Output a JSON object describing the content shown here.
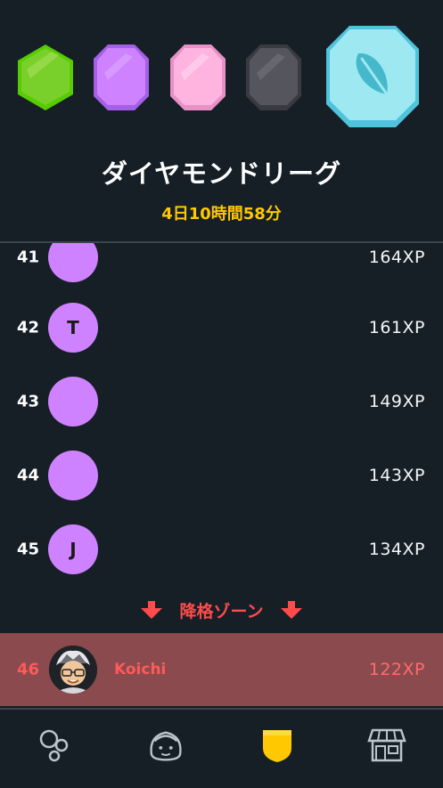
{
  "league": {
    "title": "ダイヤモンドリーグ",
    "time_remaining": "4日10時間58分"
  },
  "leaderboard": [
    {
      "rank": "41",
      "initial": "",
      "xp": "164XP"
    },
    {
      "rank": "42",
      "initial": "T",
      "xp": "161XP"
    },
    {
      "rank": "43",
      "initial": "",
      "xp": "149XP"
    },
    {
      "rank": "44",
      "initial": "",
      "xp": "143XP"
    },
    {
      "rank": "45",
      "initial": "J",
      "xp": "134XP"
    }
  ],
  "demotion_zone": {
    "label": "降格ゾーン"
  },
  "current_user": {
    "rank": "46",
    "name": "Koichi",
    "xp": "122XP"
  },
  "colors": {
    "background": "#161f26",
    "accent_gold": "#ffc800",
    "demotion_red": "#ff4b4b",
    "avatar_purple": "#ce82ff"
  },
  "tabs": [
    {
      "icon": "circles-icon"
    },
    {
      "icon": "characters-icon"
    },
    {
      "icon": "league-shield-icon"
    },
    {
      "icon": "shop-icon"
    }
  ]
}
